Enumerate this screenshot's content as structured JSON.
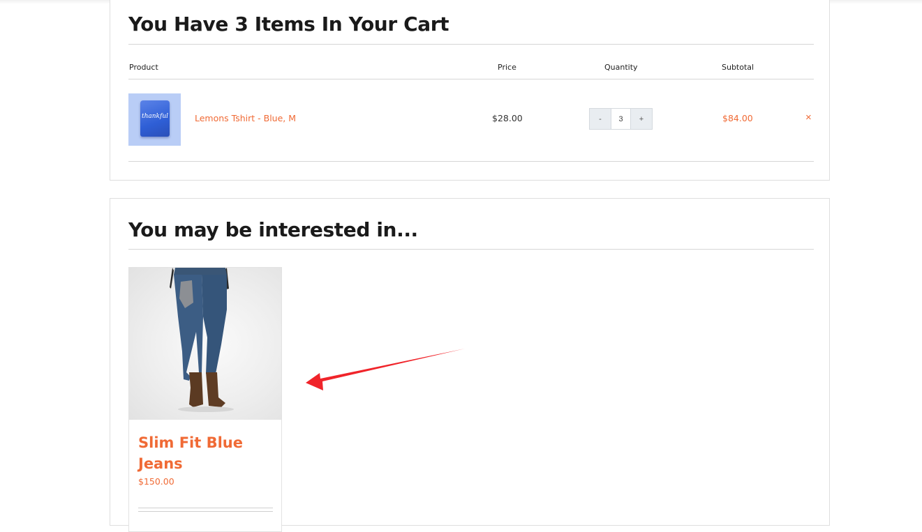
{
  "cart": {
    "title": "You Have 3 Items In Your Cart",
    "columns": {
      "product": "Product",
      "price": "Price",
      "quantity": "Quantity",
      "subtotal": "Subtotal"
    },
    "items": [
      {
        "name": "Lemons Tshirt - Blue, M",
        "image_text": "thankful",
        "price": "$28.00",
        "quantity": "3",
        "decrement_label": "-",
        "increment_label": "+",
        "subtotal": "$84.00",
        "remove_label": "×"
      }
    ]
  },
  "recommendations": {
    "title": "You may be interested in...",
    "products": [
      {
        "name": "Slim Fit Blue Jeans",
        "price": "$150.00"
      }
    ]
  },
  "colors": {
    "accent": "#f06a35",
    "annotation_arrow": "#f0242a",
    "border": "#dedede",
    "qty_button_bg": "#e9edf1"
  },
  "icons": {
    "remove": "close-icon",
    "annotation": "red-arrow-icon"
  }
}
